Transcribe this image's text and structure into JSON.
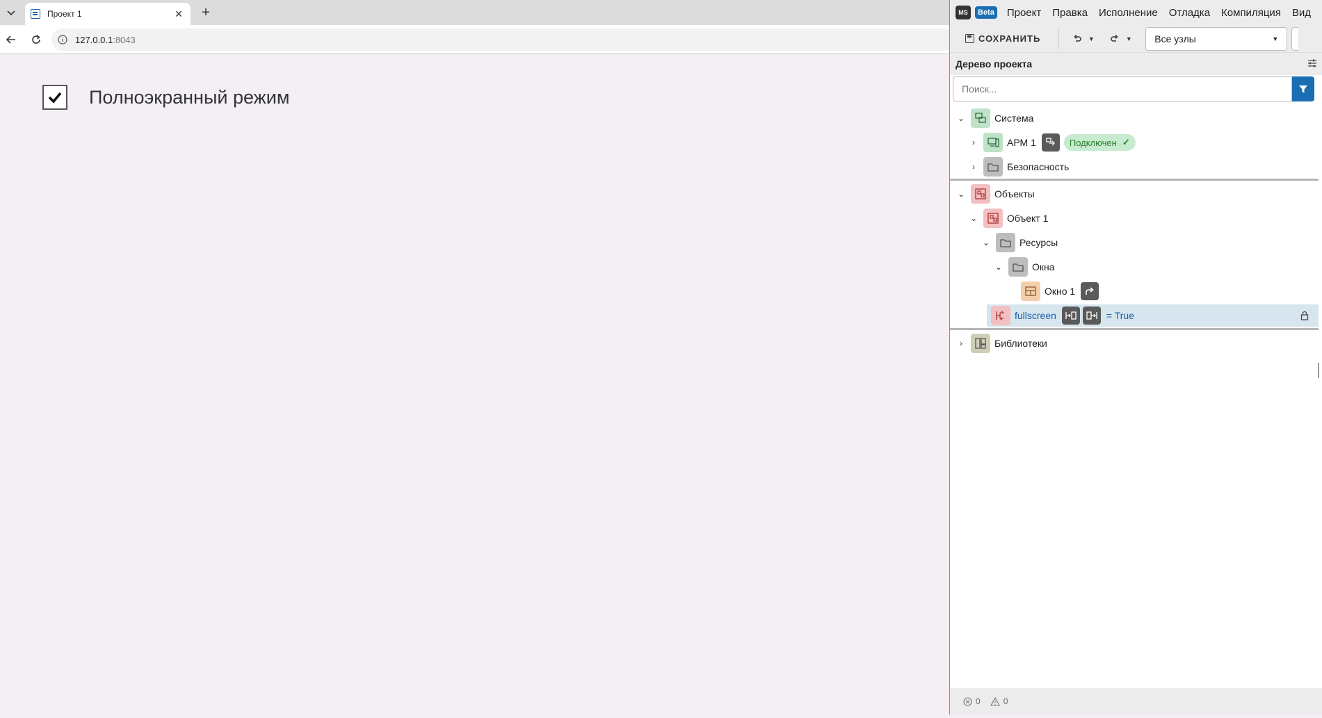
{
  "browser": {
    "tab_title": "Проект 1",
    "tab_close": "✕",
    "new_tab": "+",
    "url_host": "127.0.0.1",
    "url_port": ":8043"
  },
  "page": {
    "checkbox_checked": true,
    "checkbox_label": "Полноэкранный режим"
  },
  "ide": {
    "logo_ms": "MS",
    "logo_beta": "Beta",
    "menu": [
      "Проект",
      "Правка",
      "Исполнение",
      "Отладка",
      "Компиляция",
      "Вид"
    ],
    "toolbar": {
      "save_label": "СОХРАНИТЬ",
      "nodes_select": "Все узлы"
    },
    "tree_title": "Дерево проекта",
    "search_placeholder": "Поиск...",
    "tree": {
      "system": "Система",
      "arm": "АРМ 1",
      "status": "Подключен",
      "security": "Безопасность",
      "objects": "Объекты",
      "object1": "Объект 1",
      "resources": "Ресурсы",
      "windows": "Окна",
      "window1": "Окно 1",
      "fullscreen": "fullscreen",
      "fullscreen_value": "= True",
      "libraries": "Библиотеки"
    },
    "status_bar": {
      "errors": "0",
      "warnings": "0"
    },
    "colors": {
      "accent": "#1a6fb4",
      "selected_row": "#d6e5ee",
      "status_ok": "#c7ebce"
    }
  }
}
